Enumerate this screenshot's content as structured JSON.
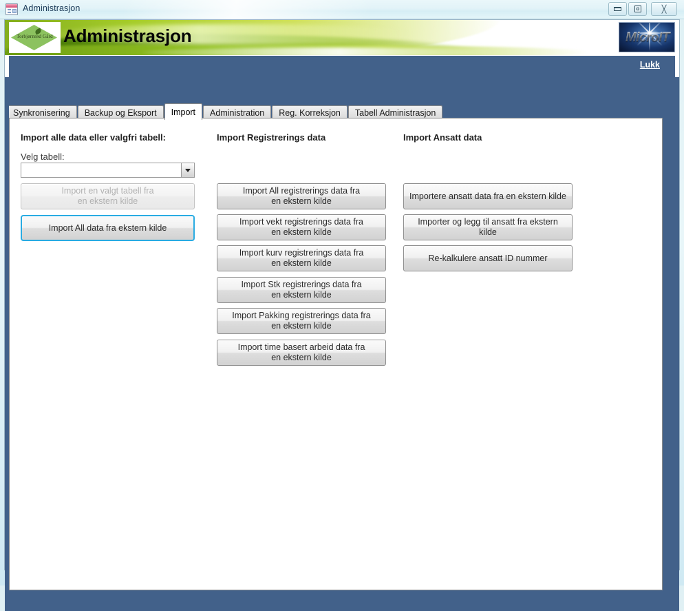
{
  "window": {
    "title": "Administrasjon",
    "icon": "access-form-icon",
    "controls": {
      "minimize": "minimize-button",
      "maximize": "restore-button",
      "close": "close-button"
    }
  },
  "banner": {
    "title": "Administrasjon",
    "farm_logo_text": "Torbjørnrød Gård",
    "vendor_logo_text": "MicroIT"
  },
  "toolbar": {
    "close_link": "Lukk"
  },
  "tabs": [
    {
      "label": "Synkronisering",
      "active": false
    },
    {
      "label": "Backup og Eksport",
      "active": false
    },
    {
      "label": "Import",
      "active": true
    },
    {
      "label": "Administration",
      "active": false
    },
    {
      "label": "Reg. Korreksjon",
      "active": false
    },
    {
      "label": "Tabell Administrasjon",
      "active": false
    }
  ],
  "columns": {
    "left": {
      "title": "Import alle data eller valgfri tabell:",
      "select_label": "Velg tabell:",
      "combo": {
        "value": "",
        "placeholder": ""
      },
      "buttons": [
        {
          "label": "Import en valgt tabell fra\nen ekstern kilde",
          "state": "disabled"
        },
        {
          "label": "Import All data fra ekstern kilde",
          "state": "focused"
        }
      ]
    },
    "middle": {
      "title": "Import Registrerings data",
      "buttons": [
        {
          "label": "Import All registrerings data fra\nen ekstern kilde",
          "state": "normal"
        },
        {
          "label": "Import vekt registrerings data fra\nen ekstern kilde",
          "state": "normal"
        },
        {
          "label": "Import kurv registrerings data fra\nen ekstern kilde",
          "state": "normal"
        },
        {
          "label": "Import Stk registrerings data fra\nen ekstern kilde",
          "state": "normal"
        },
        {
          "label": "Import Pakking registrerings data fra\nen ekstern kilde",
          "state": "normal"
        },
        {
          "label": "Import time basert arbeid data fra\nen ekstern kilde",
          "state": "normal"
        }
      ]
    },
    "right": {
      "title": "Import Ansatt data",
      "buttons": [
        {
          "label": "Importere ansatt data fra en ekstern kilde",
          "state": "normal"
        },
        {
          "label": "Importer og legg til ansatt fra ekstern kilde",
          "state": "normal"
        },
        {
          "label": "Re-kalkulere ansatt ID nummer",
          "state": "normal"
        }
      ]
    }
  },
  "colors": {
    "accent_blue": "#42618a",
    "focus_blue": "#29abe2",
    "banner_green": "#8ab81d",
    "logo_green": "#8cc25f"
  }
}
